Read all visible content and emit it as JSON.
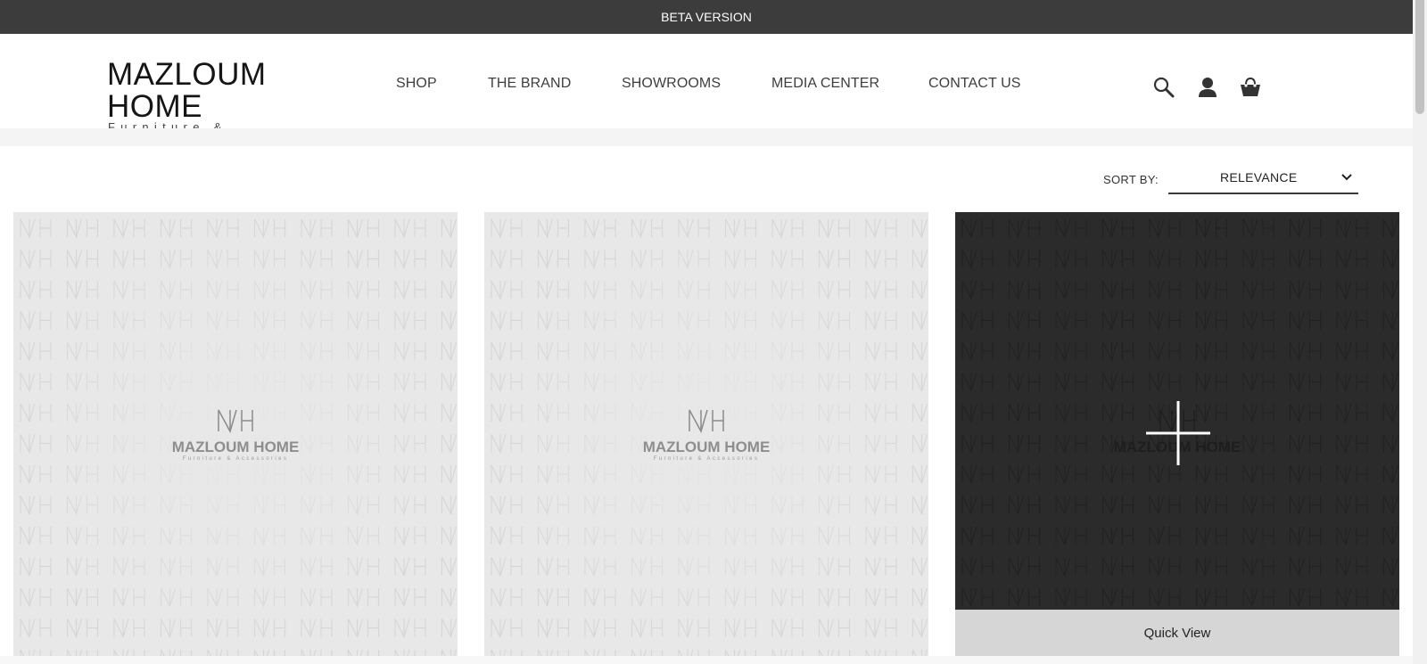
{
  "announcement": "BETA VERSION",
  "brand": {
    "name": "MAZLOUM HOME",
    "tagline": "Furniture & Accessories",
    "monogram": "MH"
  },
  "nav": {
    "items": [
      {
        "label": "SHOP"
      },
      {
        "label": "THE BRAND"
      },
      {
        "label": "SHOWROOMS"
      },
      {
        "label": "MEDIA CENTER"
      },
      {
        "label": "CONTACT US"
      }
    ]
  },
  "header_icons": [
    "search-icon",
    "account-icon",
    "cart-icon"
  ],
  "sort": {
    "label": "SORT BY:",
    "selected": "RELEVANCE"
  },
  "products": [
    {
      "placeholder": true,
      "hovered": false
    },
    {
      "placeholder": true,
      "hovered": false
    },
    {
      "placeholder": true,
      "hovered": true,
      "quick_view_label": "Quick View"
    }
  ],
  "colors": {
    "topbar": "#3c3c3c",
    "card_bg": "#e8e8e8",
    "card_hover_bg": "#2b2b2b",
    "quick_view_bg": "#d6d6d6"
  }
}
